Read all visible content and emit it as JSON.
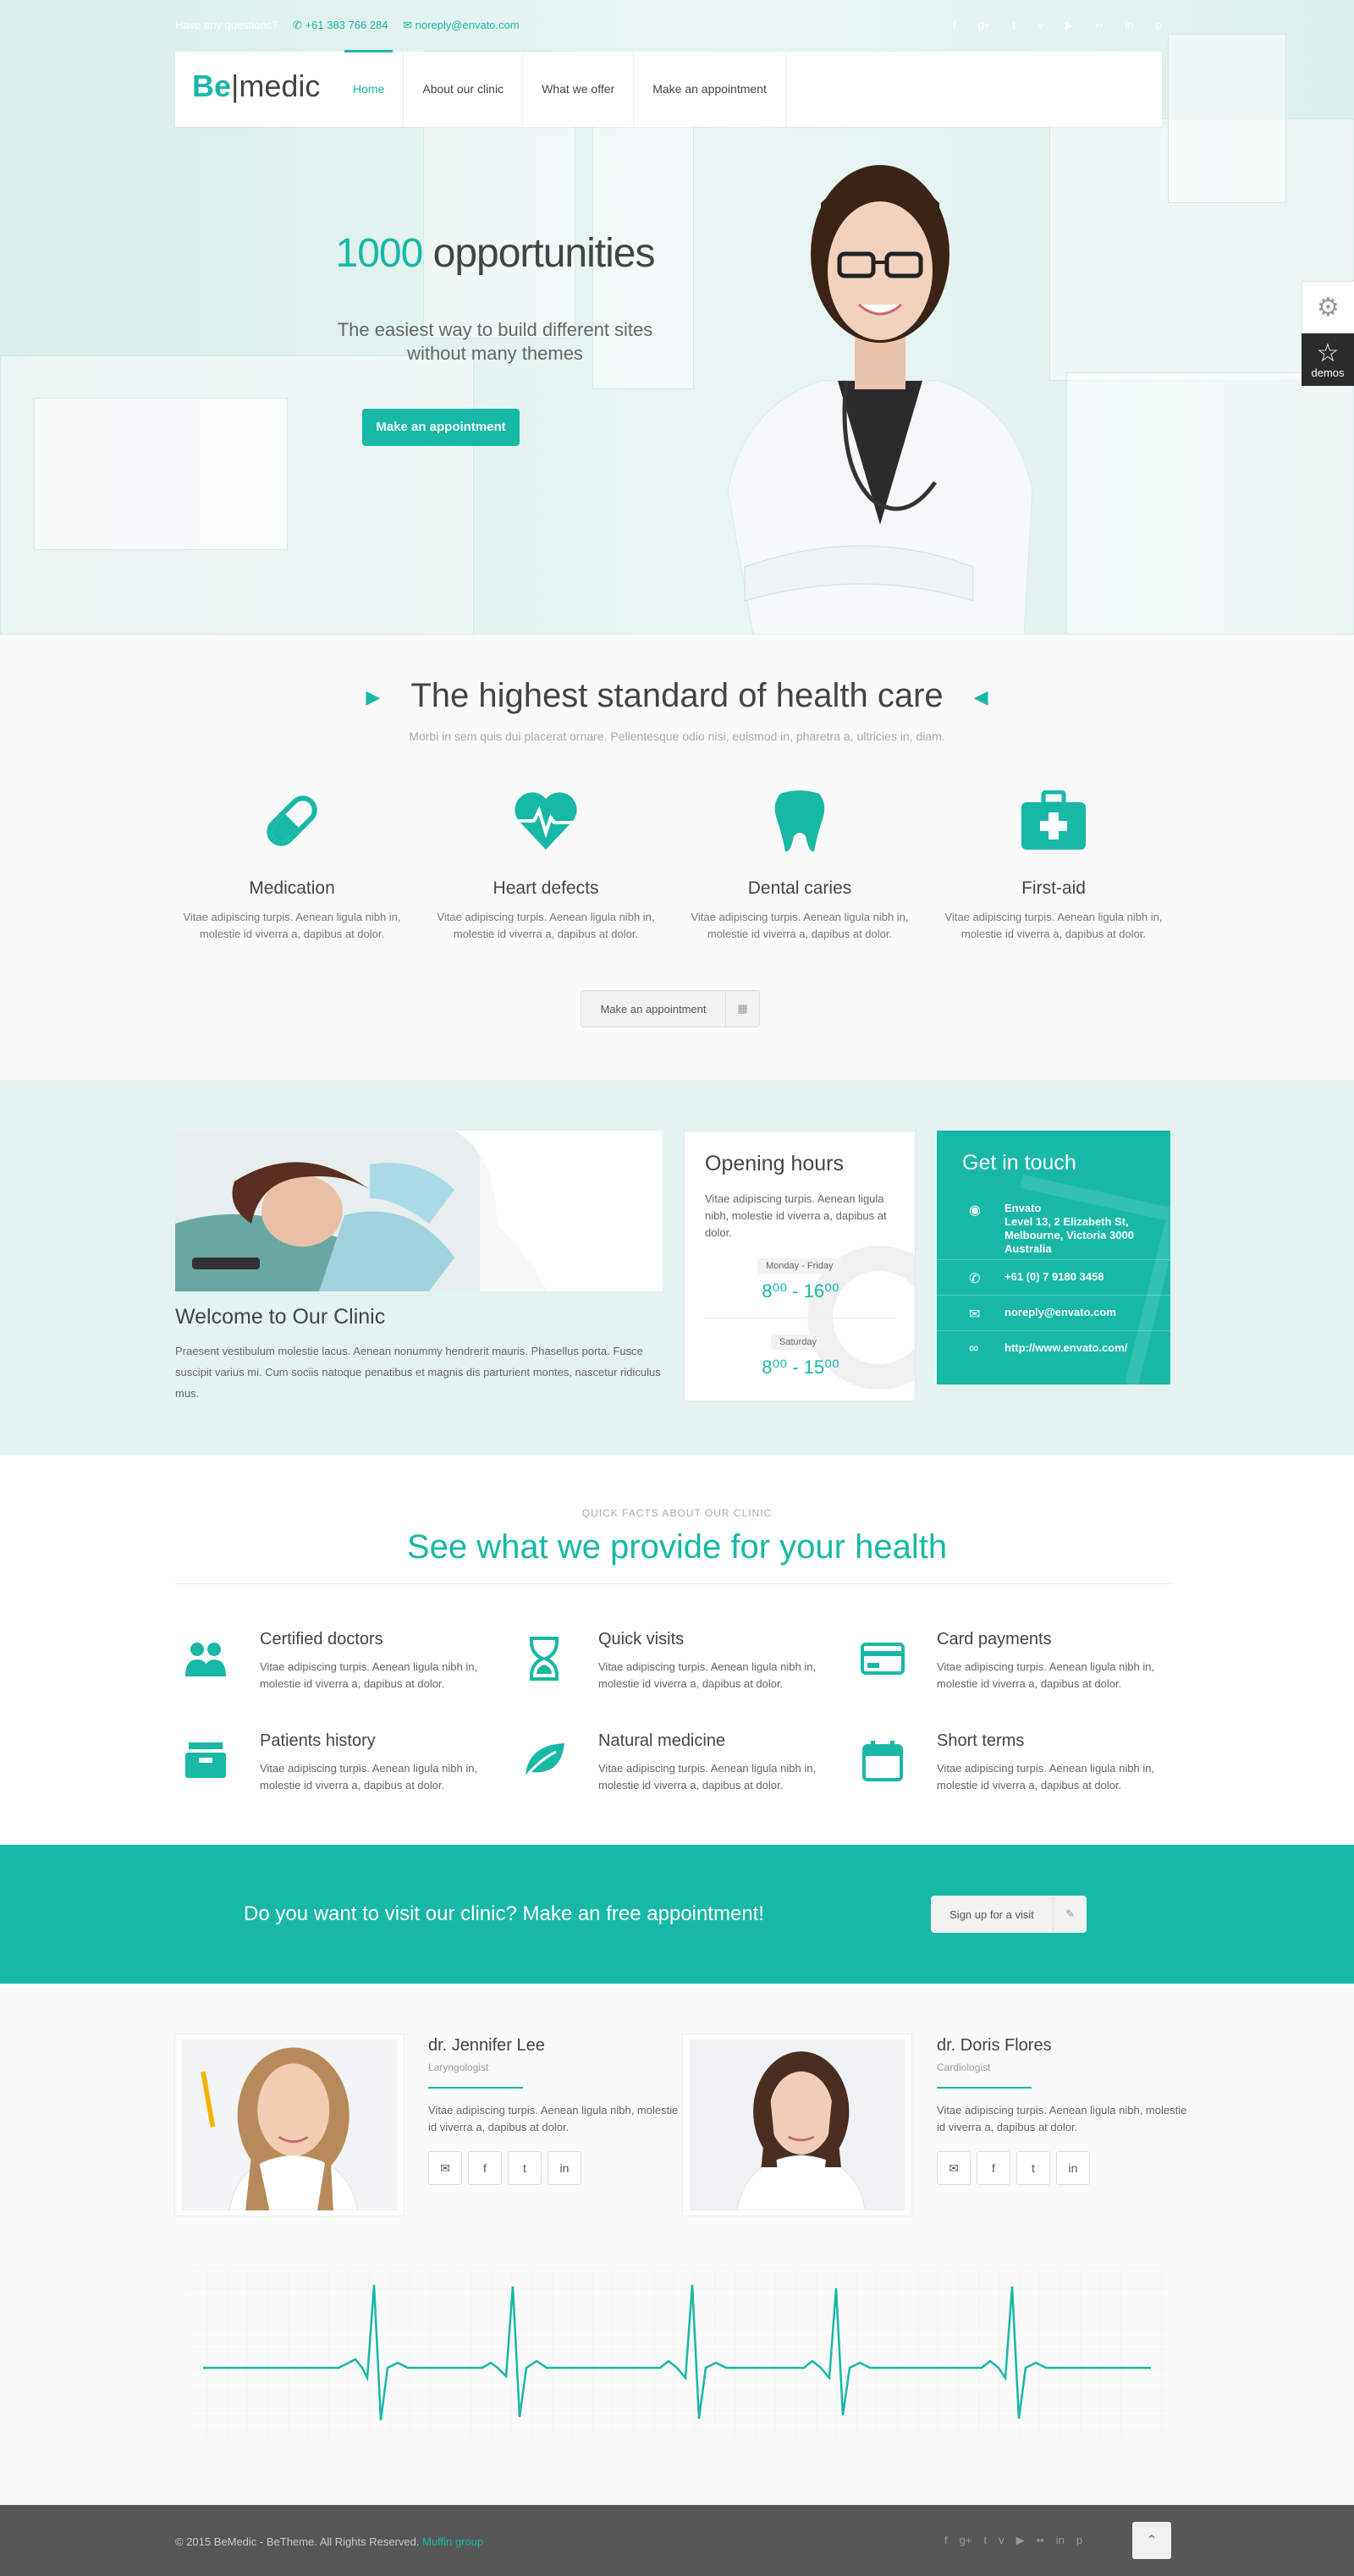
{
  "topbar": {
    "question": "Have any questions?",
    "phone": "+61 383 766 284",
    "email": "noreply@envato.com",
    "social_icons": [
      "facebook-icon",
      "google-plus-icon",
      "twitter-icon",
      "vimeo-icon",
      "youtube-icon",
      "flickr-icon",
      "linkedin-icon",
      "pinterest-icon"
    ]
  },
  "logo": {
    "be": "Be",
    "medic": "medic"
  },
  "menu": [
    {
      "label": "Home",
      "active": true
    },
    {
      "label": "About our clinic",
      "active": false
    },
    {
      "label": "What we offer",
      "active": false
    },
    {
      "label": "Make an appointment",
      "active": false
    }
  ],
  "hero": {
    "number": "1000",
    "title_rest": " opportunities",
    "subtitle_1": "The easiest way to build different sites",
    "subtitle_2": "without many themes",
    "button": "Make an appointment"
  },
  "side_panel": {
    "demos_label": "demos"
  },
  "standard": {
    "title": "The highest standard of health care",
    "subtitle": "Morbi in sem quis dui placerat ornare. Pellentesque odio nisi, euismod in, pharetra a, ultricies in, diam.",
    "features": [
      {
        "title": "Medication",
        "text": "Vitae adipiscing turpis. Aenean ligula nibh in, molestie id viverra a, dapibus at dolor."
      },
      {
        "title": "Heart defects",
        "text": "Vitae adipiscing turpis. Aenean ligula nibh in, molestie id viverra a, dapibus at dolor."
      },
      {
        "title": "Dental caries",
        "text": "Vitae adipiscing turpis. Aenean ligula nibh in, molestie id viverra a, dapibus at dolor."
      },
      {
        "title": "First-aid",
        "text": "Vitae adipiscing turpis. Aenean ligula nibh in, molestie id viverra a, dapibus at dolor."
      }
    ],
    "button": "Make an appointment"
  },
  "clinic": {
    "welcome": "Welcome to Our Clinic",
    "text": "Praesent vestibulum molestie lacus. Aenean nonummy hendrerit mauris. Phasellus porta. Fusce suscipit varius mi. Cum sociis natoque penatibus et magnis dis parturient montes, nascetur ridiculus mus.",
    "hours": {
      "title": "Opening hours",
      "text": "Vitae adipiscing turpis. Aenean ligula nibh, molestie id viverra a, dapibus at dolor.",
      "weekday_label": "Monday - Friday",
      "weekday_time": "8⁰⁰ - 16⁰⁰",
      "saturday_label": "Saturday",
      "saturday_time": "8⁰⁰ - 15⁰⁰"
    },
    "touch": {
      "title": "Get in touch",
      "company": "Envato",
      "address": "Level 13, 2 Elizabeth St, Melbourne, Victoria 3000 Australia",
      "phone": "+61 (0) 7 9180 3458",
      "email": "noreply@envato.com",
      "web": "http://www.envato.com/"
    }
  },
  "facts": {
    "kicker": "QUICK FACTS ABOUT OUR CLINIC",
    "title": "See what we provide for your health",
    "items": [
      {
        "title": "Certified doctors",
        "text": "Vitae adipiscing turpis. Aenean ligula nibh in, molestie id viverra a, dapibus at dolor.",
        "icon": "users-icon"
      },
      {
        "title": "Quick visits",
        "text": "Vitae adipiscing turpis. Aenean ligula nibh in, molestie id viverra a, dapibus at dolor.",
        "icon": "hourglass-icon"
      },
      {
        "title": "Card payments",
        "text": "Vitae adipiscing turpis. Aenean ligula nibh in, molestie id viverra a, dapibus at dolor.",
        "icon": "credit-card-icon"
      },
      {
        "title": "Patients history",
        "text": "Vitae adipiscing turpis. Aenean ligula nibh in, molestie id viverra a, dapibus at dolor.",
        "icon": "archive-icon"
      },
      {
        "title": "Natural medicine",
        "text": "Vitae adipiscing turpis. Aenean ligula nibh in, molestie id viverra a, dapibus at dolor.",
        "icon": "leaf-icon"
      },
      {
        "title": "Short terms",
        "text": "Vitae adipiscing turpis. Aenean ligula nibh in, molestie id viverra a, dapibus at dolor.",
        "icon": "calendar-icon"
      }
    ]
  },
  "banner": {
    "text": "Do you want to visit our clinic? Make an free appointment!",
    "button": "Sign up for a visit"
  },
  "doctors": [
    {
      "name": "dr. Jennifer Lee",
      "role": "Laryngologist",
      "text": "Vitae adipiscing turpis. Aenean ligula nibh, molestie id viverra a, dapibus at dolor."
    },
    {
      "name": "dr. Doris Flores",
      "role": "Cardiologist",
      "text": "Vitae adipiscing turpis. Aenean ligula nibh, molestie id viverra a, dapibus at dolor."
    }
  ],
  "footer": {
    "copyright": "© 2015 BeMedic - BeTheme. All Rights Reserved.",
    "link": "Muffin group"
  },
  "colors": {
    "accent": "#17b8a6",
    "dark": "#2b2b2b",
    "footer": "#565656"
  }
}
